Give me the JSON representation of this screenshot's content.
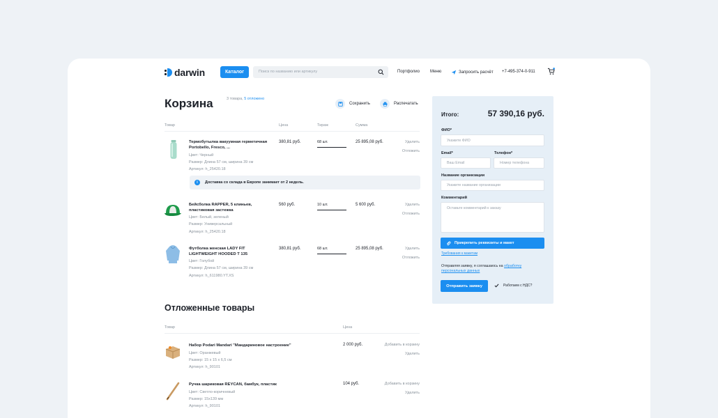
{
  "header": {
    "logo_text": "darwin",
    "catalog_label": "Каталог",
    "search_placeholder": "Поиск по названию или артикулу",
    "nav_portfolio": "Портфолио",
    "nav_menu": "Меню",
    "nav_request": "Запросить расчёт",
    "phone": "+7-495-374-0-911"
  },
  "cart": {
    "title": "Корзина",
    "count_text": "3 товара,",
    "postponed_link": "5 отложено",
    "save_label": "Сохранить",
    "print_label": "Распечатать",
    "columns": {
      "product": "Товар",
      "price": "Цена",
      "qty": "Тираж",
      "sum": "Сумма"
    },
    "items": [
      {
        "name": "Термобутылка вакуумная герметичная Portobello, Fresco, ...",
        "color": "Цвет: Черный",
        "size": "Размер: Длина 57 см, ширина 39 см",
        "sku": "Артикул: h_25420.18",
        "price": "380,81 руб.",
        "qty": "68 шт.",
        "sum": "25 895,08 руб.",
        "delete": "Удалить",
        "postpone": "Отложить"
      },
      {
        "name": "Бейсболка RAPPER, 5 клиньев, пластиковая застежка",
        "color": "Цвет: Белый, зеленый",
        "size": "Размер: Универсальный",
        "sku": "Артикул: h_25420.18",
        "price": "560 руб.",
        "qty": "10 шт.",
        "sum": "5 600 руб.",
        "delete": "Удалить",
        "postpone": "Отложить"
      },
      {
        "name": "Футболка женская LADY FIT LIGHTWEIGHT HOODED T 135",
        "color": "Цвет: Голубой",
        "size": "Размер: Длина 57 см, ширина 39 см",
        "sku": "Артикул: h_611980.YT.XS",
        "price": "380,81 руб.",
        "qty": "68 шт.",
        "sum": "25 895,08 руб.",
        "delete": "Удалить",
        "postpone": "Отложить"
      }
    ],
    "notice": "Доставка со склада в Европе занимает от 2 недель."
  },
  "postponed": {
    "title": "Отложенные товары",
    "columns": {
      "product": "Товар",
      "price": "Цена"
    },
    "items": [
      {
        "name": "Набор Podari Mandari \"Мандариновое настроение\"",
        "color": "Цвет: Оранжевый",
        "size": "Размер: 15 x 15 x 6,5 см",
        "sku": "Артикул: h_90101",
        "price": "2 000 руб.",
        "add": "Добавить в корзину",
        "delete": "Удалить"
      },
      {
        "name": "Ручка шариковая REYCAN, бамбук, пластик",
        "color": "Цвет: Светло-коричневый",
        "size": "Размер: 15x139 мм",
        "sku": "Артикул: h_90101",
        "price": "104 руб.",
        "add": "Добавить в корзину",
        "delete": "Удалить"
      }
    ]
  },
  "order": {
    "total_label": "Итого:",
    "total_value": "57 390,16 руб.",
    "name_label": "ФИО*",
    "name_placeholder": "Укажите ФИО",
    "email_label": "Email*",
    "email_placeholder": "Ваш Email",
    "phone_label": "Телефон*",
    "phone_placeholder": "Номер телефона",
    "org_label": "Название организации",
    "org_placeholder": "Укажите название организации",
    "comment_label": "Комментарий",
    "comment_placeholder": "Оставьте комментарий к заказу",
    "attach_label": "Прикрепить реквизиты и макет",
    "requirements_link": "Требования к макетам",
    "consent_text": "Отправляя заявку, я соглашаюсь на",
    "consent_link": "обработку персональных данных",
    "submit_label": "Отправить заявку",
    "vat_label": "Работаем с НДС?"
  },
  "colors": {
    "accent": "#1b8ef0",
    "panel_bg": "#e6eff7",
    "page_bg": "#eef2f6"
  }
}
